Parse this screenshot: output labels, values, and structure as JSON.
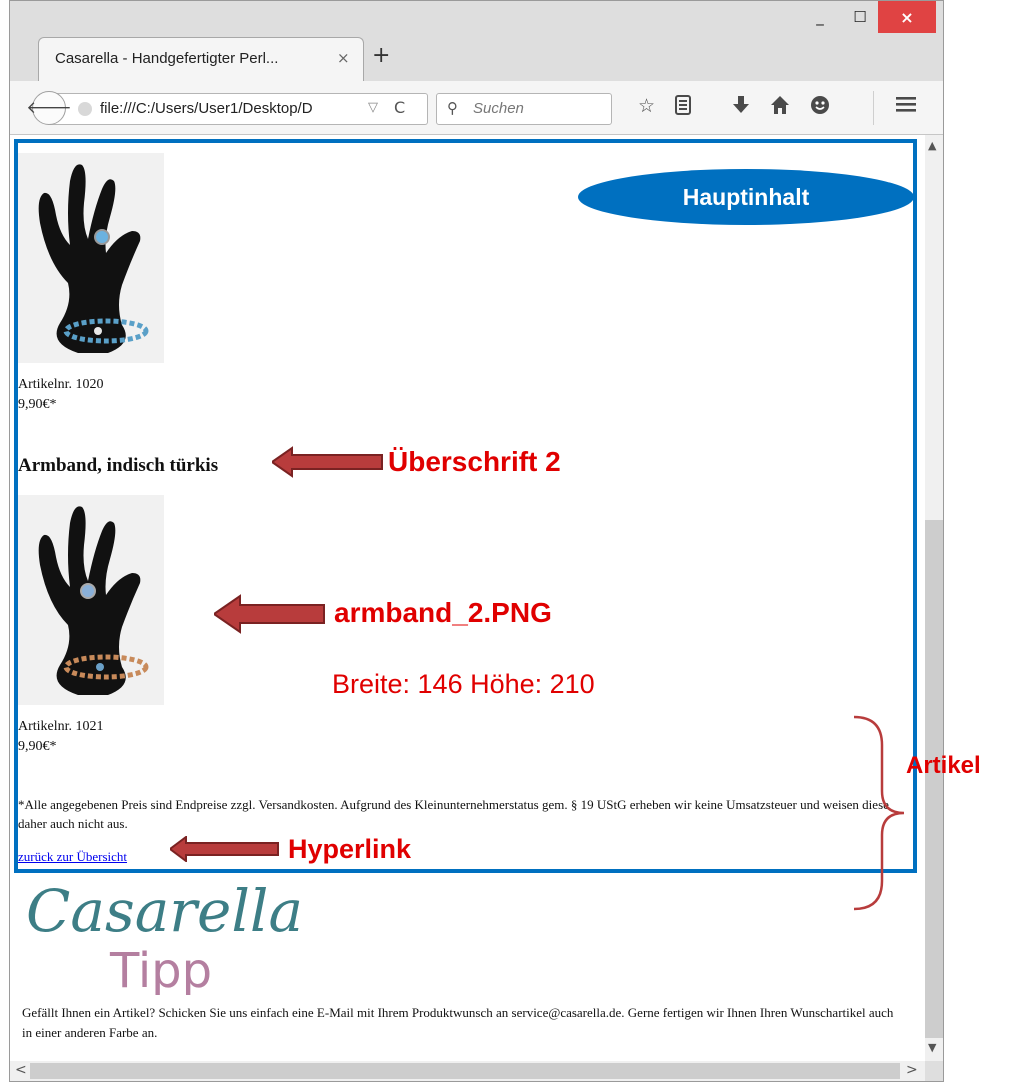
{
  "browser": {
    "tab_title": "Casarella - Handgefertigter Perl...",
    "tab_close": "×",
    "new_tab": "+",
    "url": "file:///C:/Users/User1/Desktop/D",
    "url_dropdown": "▽",
    "reload": "C",
    "search_placeholder": "Suchen",
    "window_minimize": "_",
    "window_maximize": "☐",
    "window_close": "×"
  },
  "content": {
    "product1": {
      "article": "Artikelnr. 1020",
      "price": "9,90€*"
    },
    "heading2": "Armband, indisch türkis",
    "product2": {
      "article": "Artikelnr. 1021",
      "price": "9,90€*"
    },
    "note": "*Alle angegebenen Preis sind Endpreise zzgl. Versandkosten. Aufgrund des Kleinunternehmerstatus gem. § 19 UStG erheben wir keine Umsatzsteuer und weisen diese daher auch nicht aus.",
    "back_link": "zurück zur Übersicht"
  },
  "annotations": {
    "main_label": "Hauptinhalt",
    "heading_label": "Überschrift 2",
    "image_label": "armband_2.PNG",
    "image_size": "Breite: 146 Höhe: 210",
    "link_label": "Hyperlink",
    "article_label": "Artikel"
  },
  "footer": {
    "logo_script": "Casarella",
    "logo_tipp": "Tipp",
    "text": "Gefällt Ihnen ein Artikel? Schicken Sie uns einfach eine E-Mail mit Ihrem Produktwunsch an service@casarella.de. Gerne fertigen wir Ihnen Ihren Wunschartikel auch in einer anderen Farbe an."
  },
  "colors": {
    "frame": "#0070c0",
    "annotation": "#e00000",
    "arrow": "#b83c3c",
    "close_button": "#e04343",
    "link": "#0000ee"
  },
  "icons": [
    "back-arrow-icon",
    "globe-icon",
    "reload-icon",
    "search-icon",
    "bookmark-star-icon",
    "reading-list-icon",
    "download-icon",
    "home-icon",
    "hello-icon",
    "menu-icon"
  ]
}
